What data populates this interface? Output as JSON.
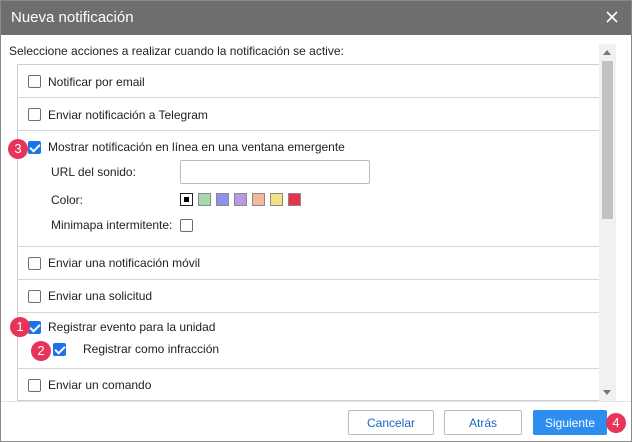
{
  "dialog": {
    "title": "Nueva notificación",
    "intro": "Seleccione acciones a realizar cuando la notificación se active:"
  },
  "options": {
    "email": {
      "label": "Notificar por email",
      "checked": false
    },
    "telegram": {
      "label": "Enviar notificación a Telegram",
      "checked": false
    },
    "popup": {
      "label": "Mostrar notificación en línea en una ventana emergente",
      "checked": true,
      "sound_url_label": "URL del sonido:",
      "sound_url_value": "",
      "color_label": "Color:",
      "colors": [
        "#ffffff",
        "#a8d8b0",
        "#8f8ff0",
        "#b89ae0",
        "#f5b89a",
        "#f5e08a",
        "#e8344a"
      ],
      "minimap_label": "Minimapa intermitente:",
      "minimap_checked": false
    },
    "mobile": {
      "label": "Enviar una notificación móvil",
      "checked": false
    },
    "request": {
      "label": "Enviar una solicitud",
      "checked": false
    },
    "event": {
      "label": "Registrar evento para la unidad",
      "checked": true,
      "violation_label": "Registrar como infracción",
      "violation_checked": true
    },
    "command": {
      "label": "Enviar un comando",
      "checked": false
    }
  },
  "footer": {
    "cancel_label": "Cancelar",
    "back_label": "Atrás",
    "next_label": "Siguiente"
  },
  "markers": {
    "m1": "1",
    "m2": "2",
    "m3": "3",
    "m4": "4"
  },
  "theme": {
    "titlebar": "#6e6e6e",
    "accent": "#2d8df0",
    "marker": "#e8345a"
  }
}
